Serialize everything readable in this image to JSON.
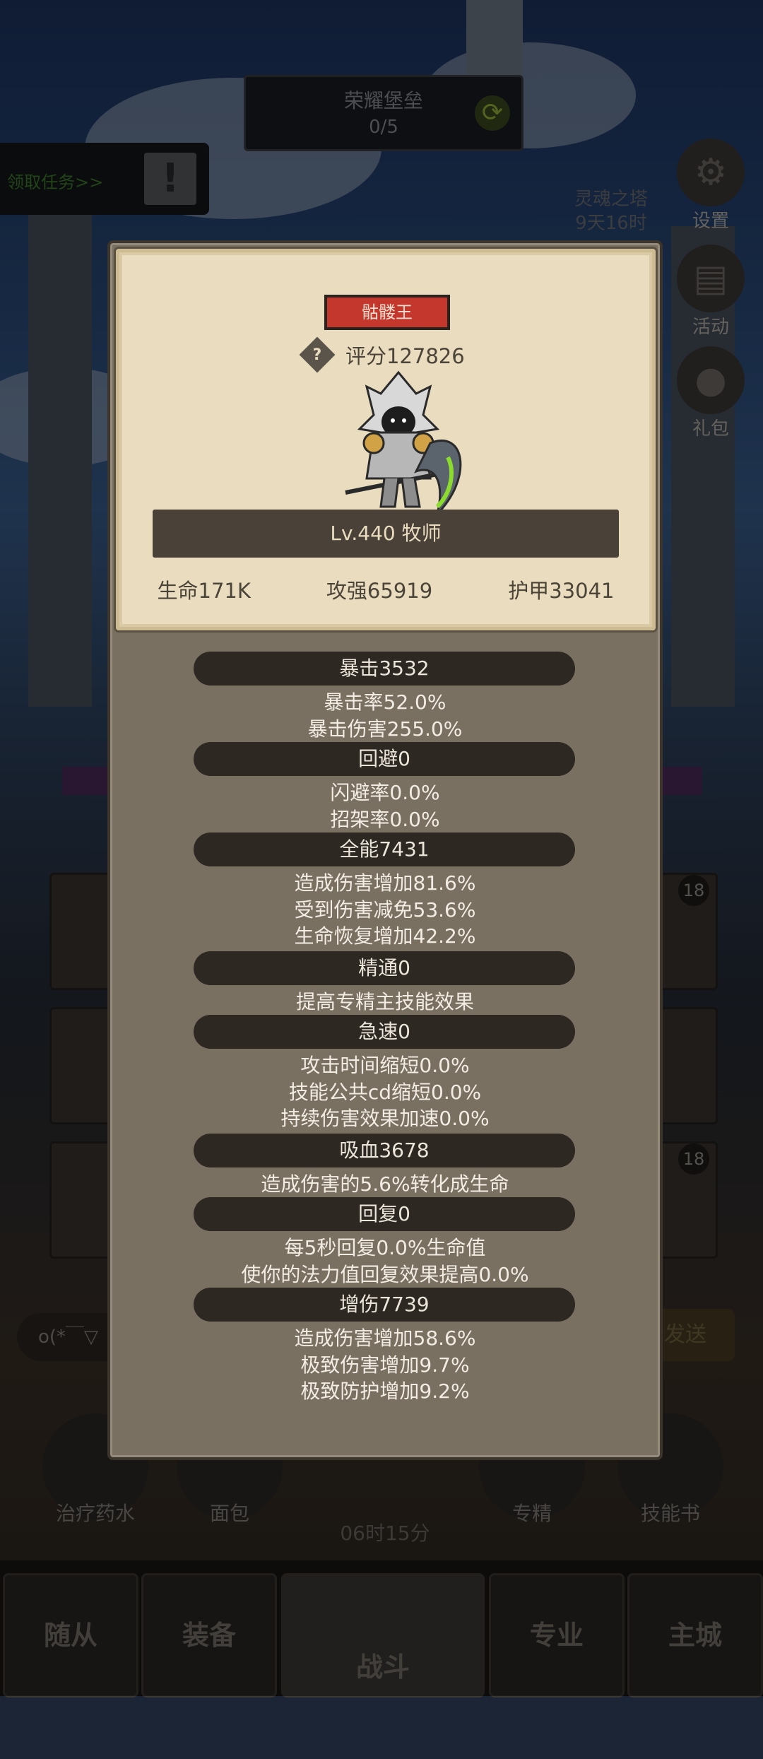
{
  "topBanner": {
    "title": "荣耀堡垒",
    "progress": "0/5"
  },
  "quest": {
    "label": "领取任务>>",
    "alert": "!"
  },
  "sideButtons": {
    "tower": "灵魂之塔",
    "towerTimer": "9天16时",
    "settings": "设置",
    "activity": "活动",
    "gift": "礼包"
  },
  "bottom": {
    "chatText": "o(*￣▽",
    "sendLabel": "发送",
    "items": [
      "治疗药水",
      "面包",
      "专精",
      "技能书"
    ],
    "timer": "06时15分",
    "badges": [
      "18",
      "18"
    ]
  },
  "nav": {
    "followers": "随从",
    "equipment": "装备",
    "battle": "战斗",
    "profession": "专业",
    "city": "主城"
  },
  "hero": {
    "name": "骷髅王",
    "score": "评分127826",
    "level": "Lv.440 牧师",
    "hp": "生命171K",
    "attack": "攻强65919",
    "armor": "护甲33041"
  },
  "sections": [
    {
      "header": "暴击3532",
      "lines": [
        "暴击率52.0%",
        "暴击伤害255.0%"
      ]
    },
    {
      "header": "回避0",
      "lines": [
        "闪避率0.0%",
        "招架率0.0%"
      ]
    },
    {
      "header": "全能7431",
      "lines": [
        "造成伤害增加81.6%",
        "受到伤害减免53.6%",
        "生命恢复增加42.2%"
      ]
    },
    {
      "header": "精通0",
      "lines": [
        "提高专精主技能效果"
      ]
    },
    {
      "header": "急速0",
      "lines": [
        "攻击时间缩短0.0%",
        "技能公共cd缩短0.0%",
        "持续伤害效果加速0.0%"
      ]
    },
    {
      "header": "吸血3678",
      "lines": [
        "造成伤害的5.6%转化成生命"
      ]
    },
    {
      "header": "回复0",
      "lines": [
        "每5秒回复0.0%生命值",
        "使你的法力值回复效果提高0.0%"
      ]
    },
    {
      "header": "增伤7739",
      "lines": [
        "造成伤害增加58.6%",
        "极致伤害增加9.7%",
        "极致防护增加9.2%"
      ]
    }
  ]
}
